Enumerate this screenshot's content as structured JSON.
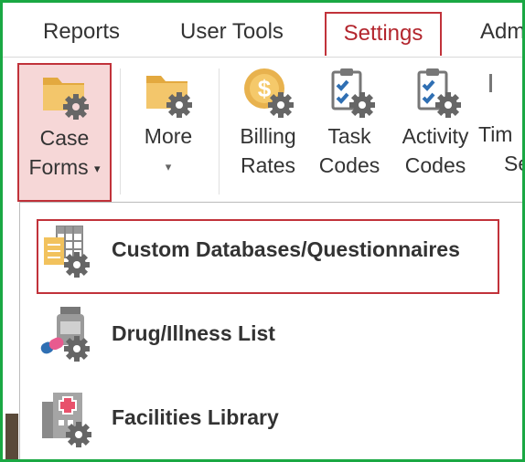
{
  "tabs": {
    "reports": "Reports",
    "user_tools": "User Tools",
    "settings": "Settings",
    "admin": "Adm"
  },
  "ribbon": {
    "case_forms": {
      "line1": "Case",
      "line2": "Forms",
      "caret": "▾",
      "icon": "folder-gear-icon"
    },
    "more": {
      "line1": "More",
      "caret": "▾",
      "icon": "folder-gear-icon"
    },
    "billing_rates": {
      "line1": "Billing",
      "line2": "Rates",
      "icon": "dollar-gear-icon"
    },
    "task_codes": {
      "line1": "Task",
      "line2": "Codes",
      "icon": "clipboard-check-gear-icon"
    },
    "activity_codes": {
      "line1": "Activity",
      "line2": "Codes",
      "icon": "clipboard-check-gear-icon"
    },
    "time_settings": {
      "line1": "Tim",
      "line2": "Se"
    }
  },
  "menu": {
    "items": [
      {
        "label": "Custom Databases/Questionnaires",
        "icon": "table-gear-icon"
      },
      {
        "label": "Drug/Illness List",
        "icon": "pill-bottle-gear-icon"
      },
      {
        "label": "Facilities Library",
        "icon": "hospital-gear-icon"
      }
    ]
  },
  "colors": {
    "highlight_border": "#c1323a",
    "highlight_fill": "#f6d7d7",
    "frame_border": "#1aa843",
    "folder": "#e8b24e"
  }
}
